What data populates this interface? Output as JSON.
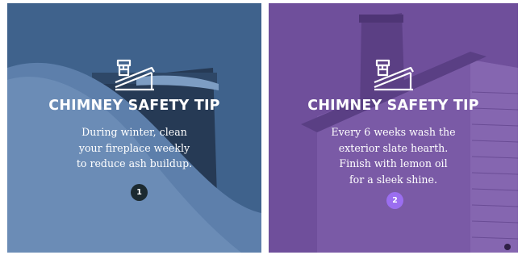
{
  "cards": [
    {
      "title": "CHIMNEY SAFETY TIP",
      "body": "During winter, clean\nyour fireplace weekly\nto reduce ash buildup.",
      "number": "1",
      "icon": "chimney-house-icon",
      "colors": {
        "overlay": "#3d5f8a",
        "badge": "#1c2a30"
      }
    },
    {
      "title": "CHIMNEY SAFETY TIP",
      "body": "Every 6 weeks wash the\nexterior slate hearth.\nFinish with lemon oil\nfor a sleek shine.",
      "number": "2",
      "icon": "chimney-house-icon",
      "colors": {
        "overlay": "#6e4e9a",
        "badge": "#9b6ef0"
      }
    }
  ]
}
